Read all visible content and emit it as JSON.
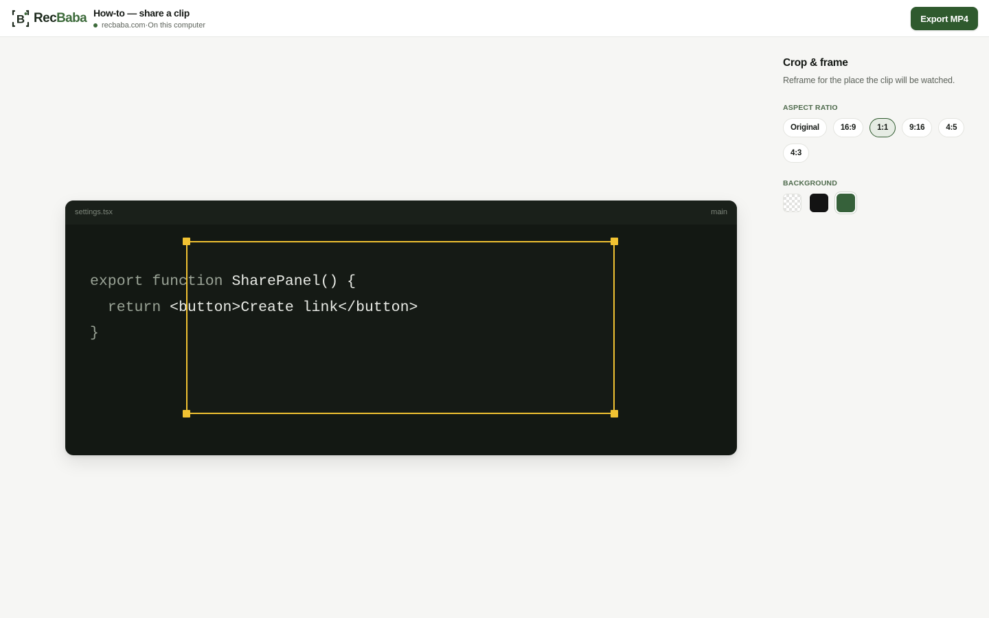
{
  "brand": {
    "name_prefix": "Rec",
    "name_suffix": "Baba",
    "logo_letter": "B",
    "colors": {
      "primary": "#2f5a2e",
      "accent": "#3c6a3a",
      "crop": "#f1c232"
    }
  },
  "header": {
    "title": "How-to — share a clip",
    "domain": "recbaba.com",
    "separator": "·",
    "location": "On this computer",
    "export_label": "Export MP4"
  },
  "preview": {
    "file_name": "settings.tsx",
    "branch": "main",
    "code": {
      "line1_kw": "export function",
      "line1_rest": " SharePanel() {",
      "line2_kw": "  return",
      "line2_rest": " <button>Create link</button>",
      "line3": "}"
    }
  },
  "panel": {
    "title": "Crop & frame",
    "description": "Reframe for the place the clip will be watched.",
    "aspect_label": "Aspect ratio",
    "ratios": [
      "Original",
      "16:9",
      "1:1",
      "9:16",
      "4:5",
      "4:3"
    ],
    "selected_ratio": "1:1",
    "background_label": "Background",
    "backgrounds": [
      {
        "name": "transparent",
        "color": "transparent"
      },
      {
        "name": "black",
        "color": "#131313"
      },
      {
        "name": "green",
        "color": "#36613a"
      }
    ],
    "selected_background": "green"
  }
}
